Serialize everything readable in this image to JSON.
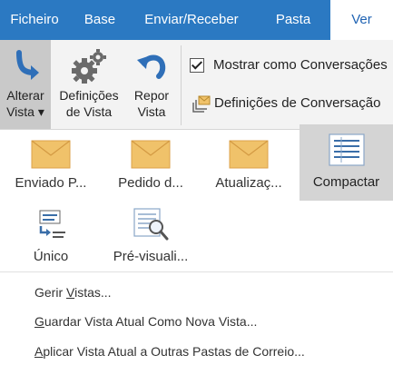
{
  "tabs": [
    {
      "label": "Ficheiro"
    },
    {
      "label": "Base"
    },
    {
      "label": "Enviar/Receber"
    },
    {
      "label": "Pasta"
    },
    {
      "label": "Ver"
    }
  ],
  "ribbon": {
    "change_view": {
      "line1": "Alterar",
      "line2": "Vista ▾"
    },
    "view_settings": {
      "line1": "Definições",
      "line2": "de Vista"
    },
    "reset_view": {
      "line1": "Repor",
      "line2": "Vista"
    },
    "show_as_conversations": {
      "label": "Mostrar como Conversações",
      "checked": true
    },
    "conversation_settings": {
      "label": "Definições de Conversação"
    }
  },
  "views": [
    {
      "label": "Enviado P...",
      "icon": "envelope-icon"
    },
    {
      "label": "Pedido d...",
      "icon": "envelope-icon"
    },
    {
      "label": "Atualizaç...",
      "icon": "envelope-icon"
    },
    {
      "label": "Compactar",
      "icon": "compact-list-icon",
      "selected": true
    },
    {
      "label": "Único",
      "icon": "single-view-icon"
    },
    {
      "label": "Pré-visuali...",
      "icon": "preview-icon"
    }
  ],
  "menu": {
    "manage_views": {
      "pre": "Gerir ",
      "ul": "V",
      "post": "istas..."
    },
    "save_view": {
      "pre": "",
      "ul": "G",
      "post": "uardar Vista Atual Como Nova Vista..."
    },
    "apply_view": {
      "pre": "",
      "ul": "A",
      "post": "plicar Vista Atual a Outras Pastas de Correio..."
    }
  },
  "colors": {
    "accent": "#2b79c2",
    "envelope": "#f0c26a",
    "selected_bg": "#c9c9c9"
  }
}
